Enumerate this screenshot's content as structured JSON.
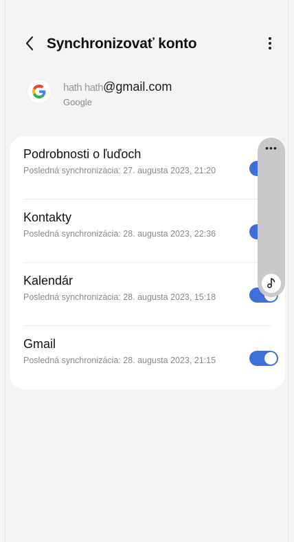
{
  "header": {
    "title": "Synchronizovať konto",
    "back_icon": "chevron-left-icon",
    "more_icon": "more-vertical-icon"
  },
  "account": {
    "email_prefix": "hath hath",
    "email": "@gmail.com",
    "type": "Google",
    "logo_icon": "google-logo-icon"
  },
  "sync_items": [
    {
      "title": "Podrobnosti o ľuďoch",
      "subtitle": "Posledná synchronizácia: 27. augusta 2023, 21:20",
      "enabled": true
    },
    {
      "title": "Kontakty",
      "subtitle": "Posledná synchronizácia: 28. augusta 2023, 22:36",
      "enabled": true
    },
    {
      "title": "Kalendár",
      "subtitle": "Posledná synchronizácia: 28. augusta 2023, 15:18",
      "enabled": true
    },
    {
      "title": "Gmail",
      "subtitle": "Posledná synchronizácia: 28. augusta 2023, 21:15",
      "enabled": true
    }
  ],
  "side_panel": {
    "menu_icon": "more-horizontal-icon",
    "music_icon": "music-note-icon"
  },
  "colors": {
    "background": "#f4f4f6",
    "card": "#ffffff",
    "toggle_on": "#3e6fd8",
    "side_panel": "#c9c9cb"
  }
}
